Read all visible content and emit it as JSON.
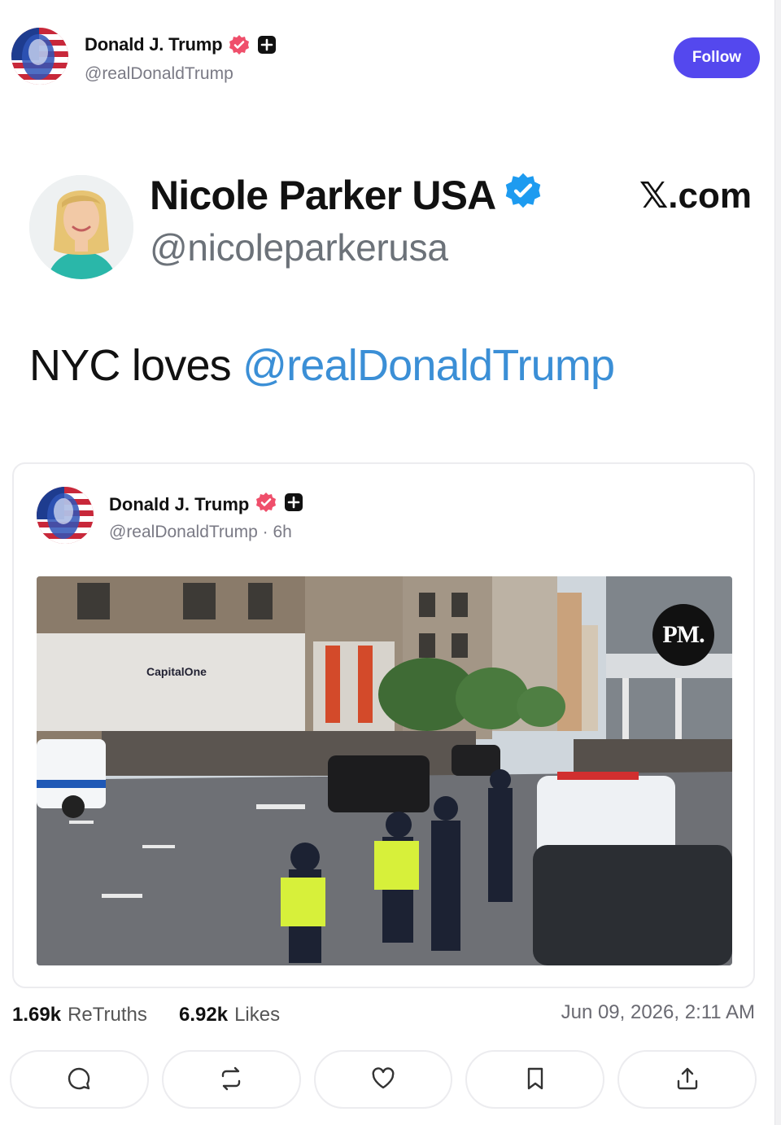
{
  "header": {
    "name": "Donald J. Trump",
    "handle": "@realDonaldTrump",
    "follow_label": "Follow"
  },
  "embedded_x_post": {
    "name": "Nicole Parker USA",
    "handle": "@nicoleparkerusa",
    "brand": "𝕏.com"
  },
  "post": {
    "text_prefix": "NYC loves ",
    "mention": "@realDonaldTrump"
  },
  "quote": {
    "name": "Donald J. Trump",
    "meta": "@realDonaldTrump · 6h",
    "media_logo": "PM."
  },
  "stats": {
    "retruths_count": "1.69k",
    "retruths_label": "ReTruths",
    "likes_count": "6.92k",
    "likes_label": "Likes",
    "timestamp": "Jun 09, 2026, 2:11 AM"
  },
  "actions": [
    {
      "icon": "reply-icon"
    },
    {
      "icon": "retruth-icon"
    },
    {
      "icon": "like-icon"
    },
    {
      "icon": "bookmark-icon"
    },
    {
      "icon": "share-icon"
    }
  ],
  "colors": {
    "accent": "#5448ee",
    "mention": "#3b8fd6",
    "verified_pink": "#ef4f6b",
    "x_verified": "#1d9bf0"
  }
}
